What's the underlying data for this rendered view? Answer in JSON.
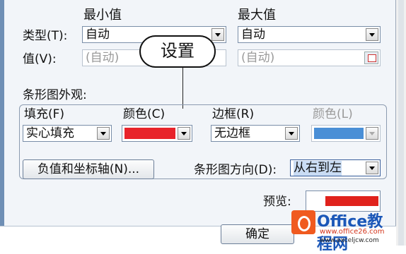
{
  "min_header": "最小值",
  "max_header": "最大值",
  "type_label": "类型(T):",
  "value_label": "值(V):",
  "min_type_value": "自动",
  "max_type_value": "自动",
  "min_value_placeholder": "(自动)",
  "max_value_placeholder": "(自动)",
  "callout_text": "设置",
  "appearance_label": "条形图外观:",
  "fill_label": "填充(F)",
  "fill_value": "实心填充",
  "color_label": "颜色(C)",
  "fill_color": "#e8232a",
  "border_label": "边框(R)",
  "border_value": "无边框",
  "border_color_label": "颜色(L)",
  "border_color": "#4a8fd6",
  "neg_axis_button": "负值和坐标轴(N)...",
  "direction_label": "条形图方向(D):",
  "direction_value": "从右到左",
  "preview_label": "预览:",
  "preview_color": "#e0221c",
  "ok_button": "确定",
  "watermark": {
    "title": "Office教程网",
    "url1": "www.office26.com",
    "url2": "www.exceljcw.com"
  }
}
